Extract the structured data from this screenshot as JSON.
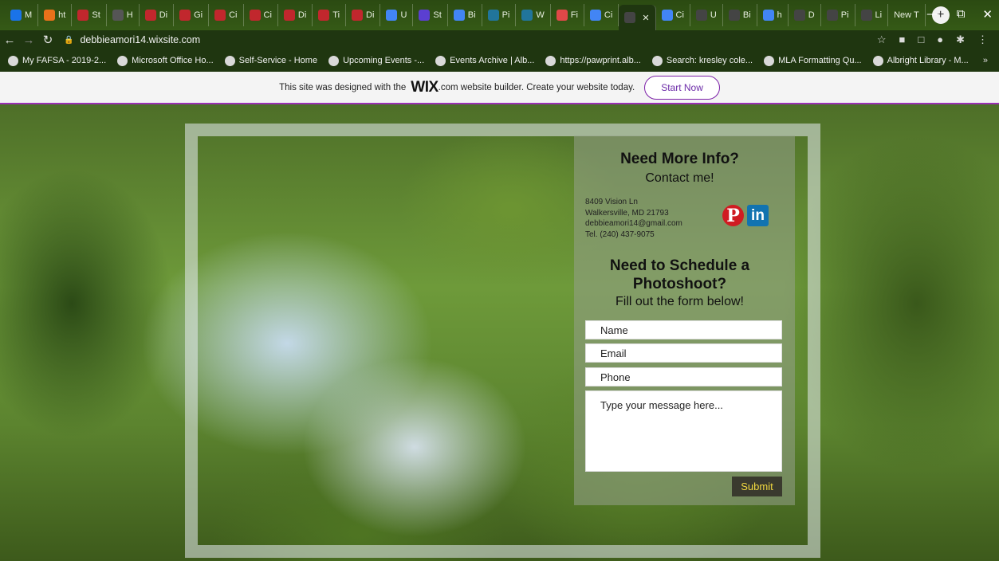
{
  "browser": {
    "tabs": [
      {
        "label": "M",
        "color": "#1a73e8"
      },
      {
        "label": "ht",
        "color": "#e8711a"
      },
      {
        "label": "St",
        "color": "#c1272d"
      },
      {
        "label": "H",
        "color": "#555555"
      },
      {
        "label": "Di",
        "color": "#c1272d"
      },
      {
        "label": "Gi",
        "color": "#c1272d"
      },
      {
        "label": "Ci",
        "color": "#c1272d"
      },
      {
        "label": "Ci",
        "color": "#c1272d"
      },
      {
        "label": "Di",
        "color": "#c1272d"
      },
      {
        "label": "Ti",
        "color": "#c1272d"
      },
      {
        "label": "Di",
        "color": "#c1272d"
      },
      {
        "label": "U",
        "color": "#4285f4"
      },
      {
        "label": "St",
        "color": "#5b3fd1"
      },
      {
        "label": "Bi",
        "color": "#4285f4"
      },
      {
        "label": "Pi",
        "color": "#21759b"
      },
      {
        "label": "W",
        "color": "#21759b"
      },
      {
        "label": "Fi",
        "color": "#e04848"
      },
      {
        "label": "Ci",
        "color": "#4285f4"
      },
      {
        "label": "",
        "color": "#444444",
        "active": true
      },
      {
        "label": "Ci",
        "color": "#4285f4"
      },
      {
        "label": "U",
        "color": "#444444"
      },
      {
        "label": "Bi",
        "color": "#444444"
      },
      {
        "label": "h",
        "color": "#4285f4"
      },
      {
        "label": "D",
        "color": "#444444"
      },
      {
        "label": "Pi",
        "color": "#444444"
      },
      {
        "label": "Li",
        "color": "#444444"
      },
      {
        "label": "New T",
        "color": ""
      }
    ],
    "url": "debbieamori14.wixsite.com",
    "bookmarks": [
      "My FAFSA - 2019-2...",
      "Microsoft Office Ho...",
      "Self-Service - Home",
      "Upcoming Events -...",
      "Events Archive | Alb...",
      "https://pawprint.alb...",
      "Search: kresley cole...",
      "MLA Formatting Qu...",
      "Albright Library - M..."
    ],
    "bookmarks_more": "»"
  },
  "wix_banner": {
    "text_before": "This site was designed with the",
    "logo": "WIX",
    "text_after": ".com website builder. Create your website today.",
    "button": "Start Now"
  },
  "contact": {
    "heading": "Need More Info?",
    "subheading": "Contact me!",
    "address_line1": "8409 Vision Ln",
    "address_line2": "Walkersville, MD 21793",
    "email": "debbieamori14@gmail.com",
    "phone": "Tel. (240) 437-9075",
    "pinterest_glyph": "P",
    "linkedin_glyph": "in"
  },
  "schedule": {
    "heading": "Need to Schedule a Photoshoot?",
    "subheading": "Fill out the form below!",
    "fields": {
      "name": "Name",
      "email": "Email",
      "phone": "Phone",
      "message": "Type your message here..."
    },
    "submit": "Submit"
  }
}
